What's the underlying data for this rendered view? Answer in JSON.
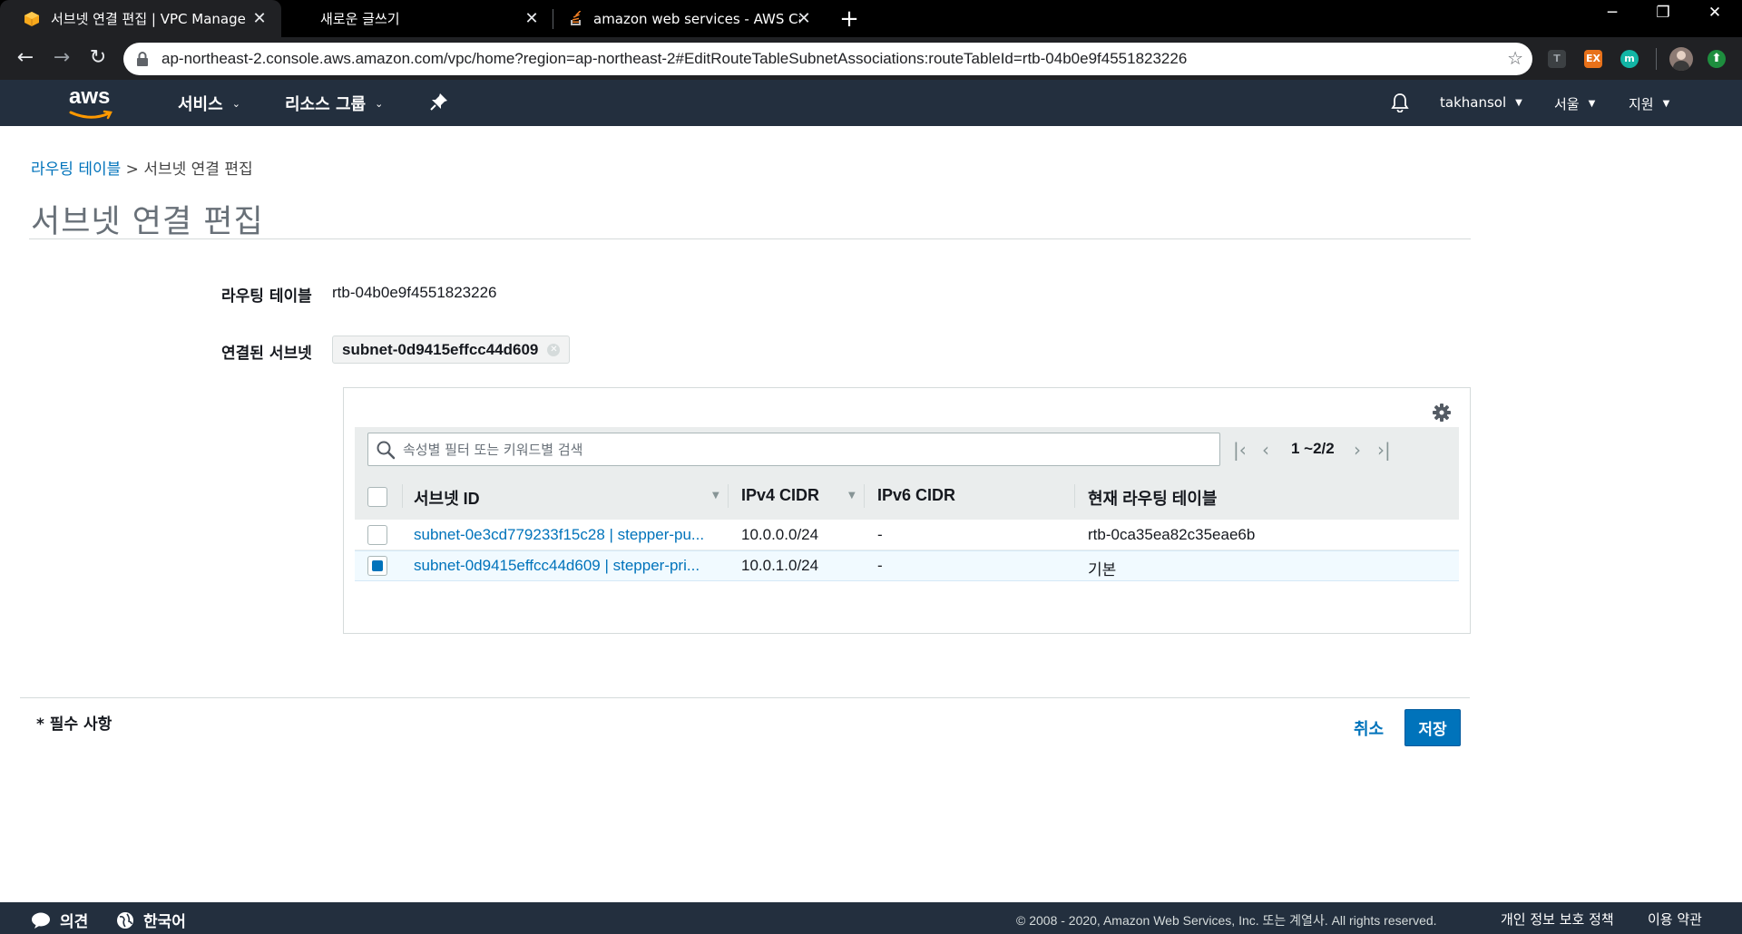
{
  "browser": {
    "tabs": [
      {
        "title": "서브넷 연결 편집 | VPC Manage",
        "active": true,
        "favicon": "aws-box-icon"
      },
      {
        "title": "새로운 글쓰기",
        "active": false,
        "favicon": ""
      },
      {
        "title": "amazon web services - AWS Ca",
        "active": false,
        "favicon": "stackoverflow-icon"
      }
    ],
    "new_tab": "+",
    "url": "ap-northeast-2.console.aws.amazon.com/vpc/home?region=ap-northeast-2#EditRouteTableSubnetAssociations:routeTableId=rtb-04b0e9f4551823226",
    "extensions": [
      {
        "name": "t-extension-icon",
        "label": "T",
        "color": "#3c4043"
      },
      {
        "name": "ex-extension-icon",
        "label": "EX",
        "color": "#e8711a"
      },
      {
        "name": "m-extension-icon",
        "label": "m",
        "color": "#12b5a5"
      },
      {
        "name": "update-icon",
        "label": "",
        "color": "#1e8e3e"
      }
    ]
  },
  "aws_header": {
    "logo_text": "aws",
    "services": "서비스",
    "resource_groups": "리소스 그룹",
    "user": "takhansol",
    "region": "서울",
    "support": "지원"
  },
  "breadcrumb": {
    "parent": "라우팅 테이블",
    "separator": ">",
    "current": "서브넷 연결 편집"
  },
  "page_title": "서브넷 연결 편집",
  "form": {
    "route_table_label": "라우팅 테이블",
    "route_table_value": "rtb-04b0e9f4551823226",
    "associated_label": "연결된 서브넷",
    "associated_token": "subnet-0d9415effcc44d609"
  },
  "table": {
    "search_placeholder": "속성별 필터 또는 키워드별 검색",
    "pagination": "1 ~2/2",
    "columns": [
      "서브넷 ID",
      "IPv4 CIDR",
      "IPv6 CIDR",
      "현재 라우팅 테이블"
    ],
    "rows": [
      {
        "subnet": "subnet-0e3cd779233f15c28 | stepper-pu...",
        "ipv4": "10.0.0.0/24",
        "ipv6": "-",
        "route_table": "rtb-0ca35ea82c35eae6b",
        "checked": false
      },
      {
        "subnet": "subnet-0d9415effcc44d609 | stepper-pri...",
        "ipv4": "10.0.1.0/24",
        "ipv6": "-",
        "route_table": "기본",
        "checked": true
      }
    ]
  },
  "footer_actions": {
    "required_note": "* 필수 사항",
    "cancel": "취소",
    "save": "저장"
  },
  "console_footer": {
    "feedback": "의견",
    "language": "한국어",
    "copyright": "© 2008 - 2020, Amazon Web Services, Inc. 또는 계열사. All rights reserved.",
    "privacy": "개인 정보 보호 정책",
    "terms": "이용 약관"
  },
  "colors": {
    "aws_nav": "#232f3e",
    "link": "#0073bb",
    "primary_button": "#0073bb",
    "aws_orange": "#ff9900"
  }
}
